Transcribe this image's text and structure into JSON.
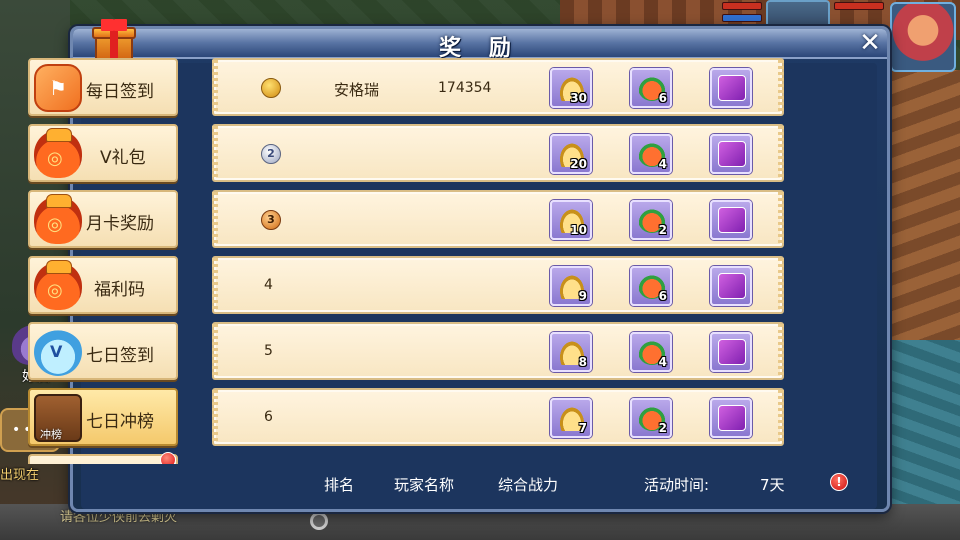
{
  "dialog": {
    "title": "奖 励",
    "close": "✕"
  },
  "sidebar": {
    "items": [
      {
        "label": "每日签到",
        "icon": "daily-checkin-icon"
      },
      {
        "label": "V礼包",
        "icon": "vip-bag-icon"
      },
      {
        "label": "月卡奖励",
        "icon": "month-card-bag-icon"
      },
      {
        "label": "福利码",
        "icon": "welfare-code-bag-icon"
      },
      {
        "label": "七日签到",
        "icon": "seven-day-checkin-icon"
      },
      {
        "label": "七日冲榜",
        "icon": "seven-day-rank-chest-icon",
        "icon_text": "冲榜"
      }
    ]
  },
  "ranking": {
    "rows": [
      {
        "rank": "1",
        "medal": "gold",
        "name": "安格瑞",
        "power": "174354",
        "rewards": [
          "30",
          "6",
          ""
        ]
      },
      {
        "rank": "2",
        "medal": "silver",
        "name": "",
        "power": "",
        "rewards": [
          "20",
          "4",
          ""
        ]
      },
      {
        "rank": "3",
        "medal": "bronze",
        "name": "",
        "power": "",
        "rewards": [
          "10",
          "2",
          ""
        ]
      },
      {
        "rank": "4",
        "medal": "",
        "name": "",
        "power": "",
        "rewards": [
          "9",
          "6",
          ""
        ]
      },
      {
        "rank": "5",
        "medal": "",
        "name": "",
        "power": "",
        "rewards": [
          "8",
          "4",
          ""
        ]
      },
      {
        "rank": "6",
        "medal": "",
        "name": "",
        "power": "",
        "rewards": [
          "7",
          "2",
          ""
        ]
      }
    ],
    "reward_icons": [
      "gold-ingot-icon",
      "treasure-pouch-icon",
      "purple-scroll-icon"
    ]
  },
  "footer": {
    "rank_label": "排名",
    "player_label": "玩家名称",
    "power_label": "综合战力",
    "time_label": "活动时间:",
    "time_value": "7天",
    "alert": "!"
  },
  "hud": {
    "friend_label": "好友",
    "side_text_1": "出现在",
    "scroll_text": "请各位少侠前去剿灭"
  },
  "colors": {
    "panel_bg": "#1c355e",
    "row_bg": "#f8e6c2",
    "header": "#5873a3",
    "text_dark": "#3a2a12"
  }
}
